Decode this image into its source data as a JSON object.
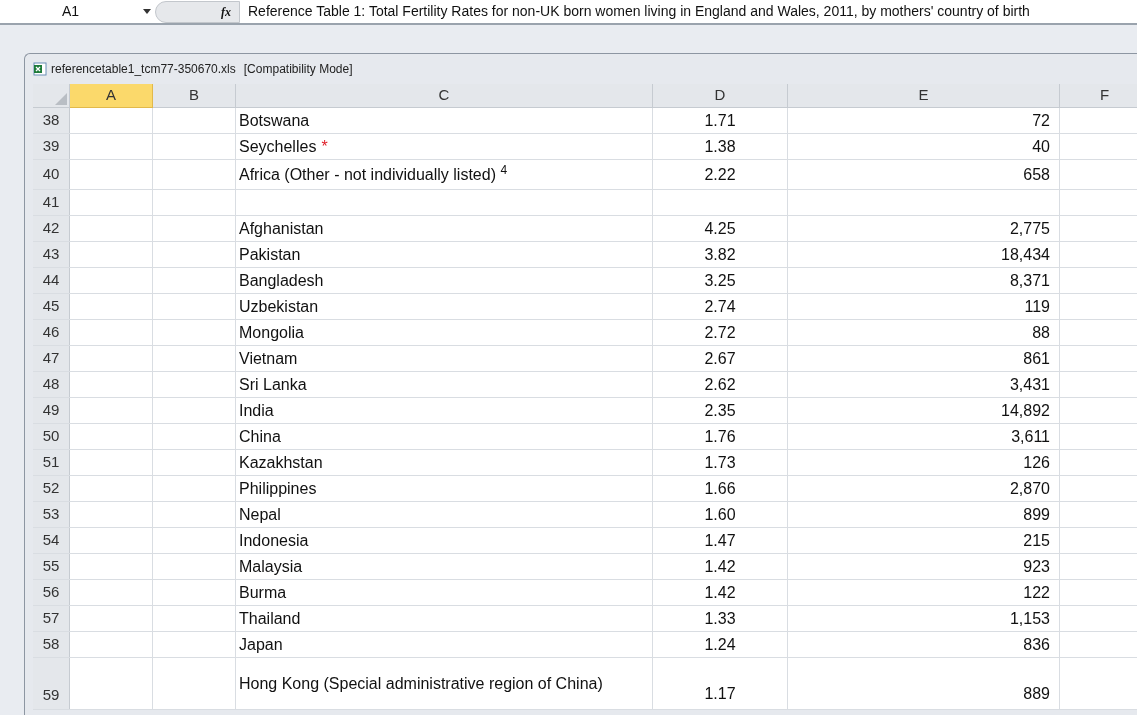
{
  "formula_bar": {
    "name_box": "A1",
    "fx_label": "fx",
    "formula": "Reference Table 1: Total Fertility Rates for non-UK born women living in England and Wales, 2011, by mothers' country of birth"
  },
  "workbook": {
    "title": "referencetable1_tcm77-350670.xls",
    "mode": "[Compatibility Mode]"
  },
  "columns": [
    {
      "label": "A",
      "selected": true
    },
    {
      "label": "B",
      "selected": false
    },
    {
      "label": "C",
      "selected": false
    },
    {
      "label": "D",
      "selected": false
    },
    {
      "label": "E",
      "selected": false
    },
    {
      "label": "F",
      "selected": false
    }
  ],
  "rows": [
    {
      "num": "38",
      "country": "Botswana",
      "rate": "1.71",
      "births": "72",
      "tall": false
    },
    {
      "num": "39",
      "country": "Seychelles",
      "marker": "*",
      "rate": "1.38",
      "births": "40",
      "tall": false
    },
    {
      "num": "40",
      "country": "Africa (Other - not individually listed) $^{4}$",
      "rate": "2.22",
      "births": "658",
      "tall": false
    },
    {
      "num": "41",
      "tall": false
    },
    {
      "num": "42",
      "country": "Afghanistan",
      "rate": "4.25",
      "births": "2,775",
      "tall": false
    },
    {
      "num": "43",
      "country": "Pakistan",
      "rate": "3.82",
      "births": "18,434",
      "tall": false
    },
    {
      "num": "44",
      "country": "Bangladesh",
      "rate": "3.25",
      "births": "8,371",
      "tall": false
    },
    {
      "num": "45",
      "country": "Uzbekistan",
      "rate": "2.74",
      "births": "119",
      "tall": false
    },
    {
      "num": "46",
      "country": "Mongolia",
      "rate": "2.72",
      "births": "88",
      "tall": false
    },
    {
      "num": "47",
      "country": "Vietnam",
      "rate": "2.67",
      "births": "861",
      "tall": false
    },
    {
      "num": "48",
      "country": "Sri Lanka",
      "rate": "2.62",
      "births": "3,431",
      "tall": false
    },
    {
      "num": "49",
      "country": "India",
      "rate": "2.35",
      "births": "14,892",
      "tall": false
    },
    {
      "num": "50",
      "country": "China",
      "rate": "1.76",
      "births": "3,611",
      "tall": false
    },
    {
      "num": "51",
      "country": "Kazakhstan",
      "rate": "1.73",
      "births": "126",
      "tall": false
    },
    {
      "num": "52",
      "country": "Philippines",
      "rate": "1.66",
      "births": "2,870",
      "tall": false
    },
    {
      "num": "53",
      "country": "Nepal",
      "rate": "1.60",
      "births": "899",
      "tall": false
    },
    {
      "num": "54",
      "country": "Indonesia",
      "rate": "1.47",
      "births": "215",
      "tall": false
    },
    {
      "num": "55",
      "country": "Malaysia",
      "rate": "1.42",
      "births": "923",
      "tall": false
    },
    {
      "num": "56",
      "country": "Burma",
      "rate": "1.42",
      "births": "122",
      "tall": false
    },
    {
      "num": "57",
      "country": "Thailand",
      "rate": "1.33",
      "births": "1,153",
      "tall": false
    },
    {
      "num": "58",
      "country": "Japan",
      "rate": "1.24",
      "births": "836",
      "tall": false
    },
    {
      "num": "59",
      "country": "Hong Kong (Special administrative region of China)",
      "rate": "1.17",
      "births": "889",
      "tall": true
    }
  ]
}
